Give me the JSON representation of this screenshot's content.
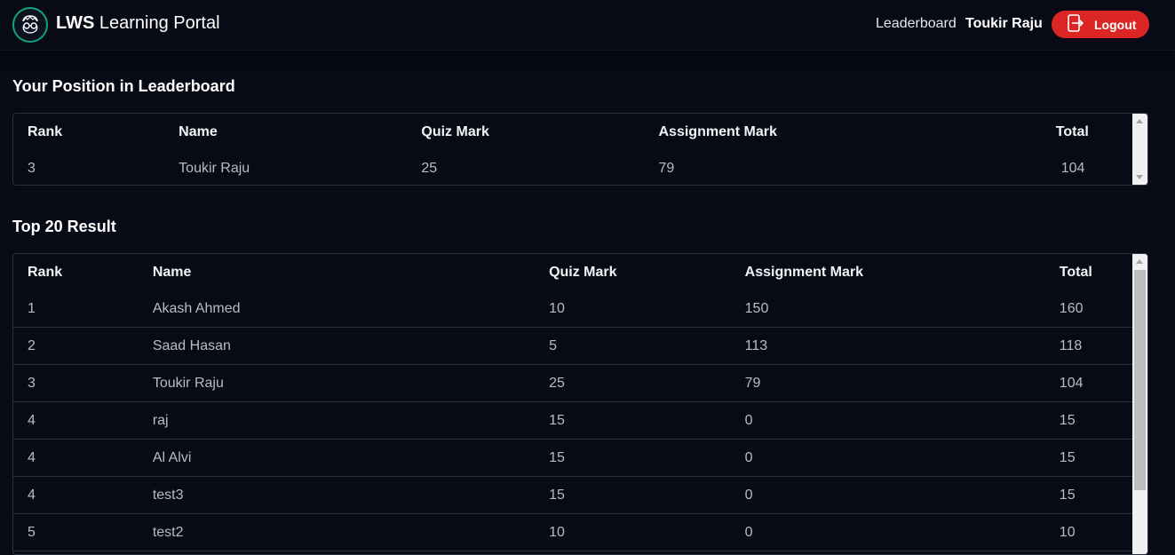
{
  "header": {
    "brand_bold": "LWS",
    "brand_rest": " Learning Portal",
    "nav_leaderboard": "Leaderboard",
    "user_name": "Toukir Raju",
    "logout_label": "Logout"
  },
  "position": {
    "title": "Your Position in Leaderboard",
    "columns": [
      "Rank",
      "Name",
      "Quiz Mark",
      "Assignment Mark",
      "Total"
    ],
    "row": [
      "3",
      "Toukir Raju",
      "25",
      "79",
      "104"
    ]
  },
  "top": {
    "title": "Top 20 Result",
    "columns": [
      "Rank",
      "Name",
      "Quiz Mark",
      "Assignment Mark",
      "Total"
    ],
    "rows": [
      [
        "1",
        "Akash Ahmed",
        "10",
        "150",
        "160"
      ],
      [
        "2",
        "Saad Hasan",
        "5",
        "113",
        "118"
      ],
      [
        "3",
        "Toukir Raju",
        "25",
        "79",
        "104"
      ],
      [
        "4",
        "raj",
        "15",
        "0",
        "15"
      ],
      [
        "4",
        "Al Alvi",
        "15",
        "0",
        "15"
      ],
      [
        "4",
        "test3",
        "15",
        "0",
        "15"
      ],
      [
        "5",
        "test2",
        "10",
        "0",
        "10"
      ]
    ]
  },
  "colors": {
    "background": "#080b16",
    "brand_accent": "#13a37c",
    "logout": "#dc2626"
  }
}
